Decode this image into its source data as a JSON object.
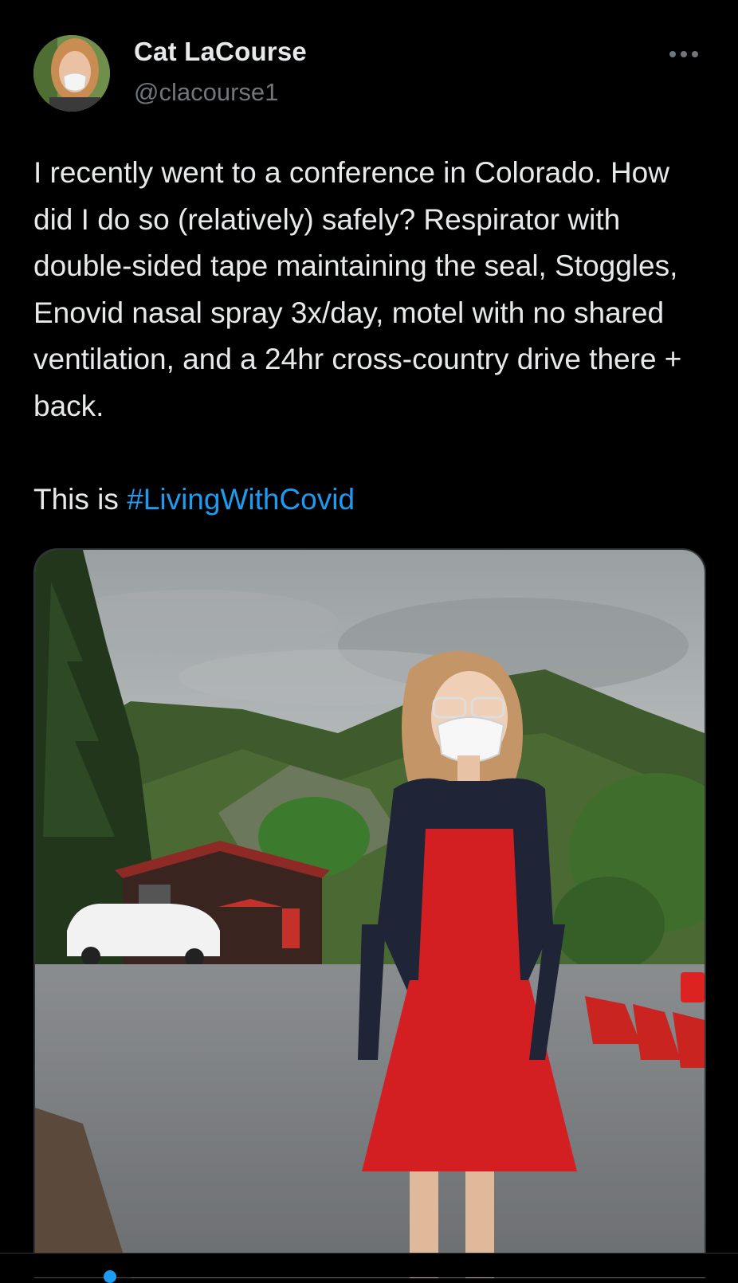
{
  "author": {
    "name": "Cat LaCourse",
    "handle": "@clacourse1"
  },
  "tweet": {
    "body": "I recently went to a conference in Colorado. How did I do so (relatively) safely? Respirator with double-sided tape maintaining the seal, Stoggles, Enovid nasal spray 3x/day, motel with no shared ventilation, and a 24hr cross-country drive there + back.",
    "closing_prefix": "This is ",
    "hashtag": "#LivingWithCovid"
  },
  "icons": {
    "more": "more-horizontal-icon"
  },
  "colors": {
    "background": "#000000",
    "text": "#e7e9ea",
    "muted": "#71767b",
    "accent": "#1d9bf0"
  }
}
